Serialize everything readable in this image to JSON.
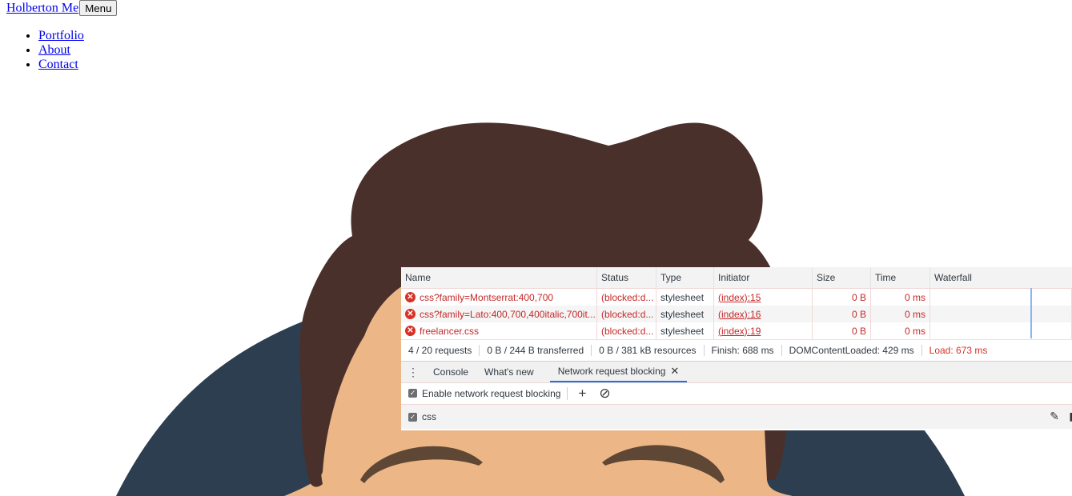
{
  "page": {
    "brand": "Holberton Me",
    "menu_button": "Menu",
    "nav": [
      "Portfolio",
      "About",
      "Contact"
    ]
  },
  "avatar": {
    "colors": {
      "circle": "#2c3e50",
      "hair": "#4a302b",
      "skin": "#edb687",
      "eyebrow": "#5e4734"
    }
  },
  "network": {
    "columns": [
      "Name",
      "Status",
      "Type",
      "Initiator",
      "Size",
      "Time",
      "Waterfall"
    ],
    "rows": [
      {
        "name": "css?family=Montserrat:400,700",
        "status": "(blocked:d...",
        "type": "stylesheet",
        "initiator": "(index):15",
        "size": "0 B",
        "time": "0 ms"
      },
      {
        "name": "css?family=Lato:400,700,400italic,700it...",
        "status": "(blocked:d...",
        "type": "stylesheet",
        "initiator": "(index):16",
        "size": "0 B",
        "time": "0 ms"
      },
      {
        "name": "freelancer.css",
        "status": "(blocked:d...",
        "type": "stylesheet",
        "initiator": "(index):19",
        "size": "0 B",
        "time": "0 ms"
      }
    ],
    "summary": {
      "requests": "4 / 20 requests",
      "transferred": "0 B / 244 B transferred",
      "resources": "0 B / 381 kB resources",
      "finish": "Finish: 688 ms",
      "dcl": "DOMContentLoaded: 429 ms",
      "load": "Load: 673 ms"
    },
    "error_color": "#c62828"
  },
  "drawer": {
    "tabs": [
      "Console",
      "What's new",
      "Network request blocking"
    ],
    "enable_label": "Enable network request blocking",
    "enable_checked": true,
    "patterns": [
      {
        "pattern": "css",
        "checked": true
      }
    ]
  }
}
